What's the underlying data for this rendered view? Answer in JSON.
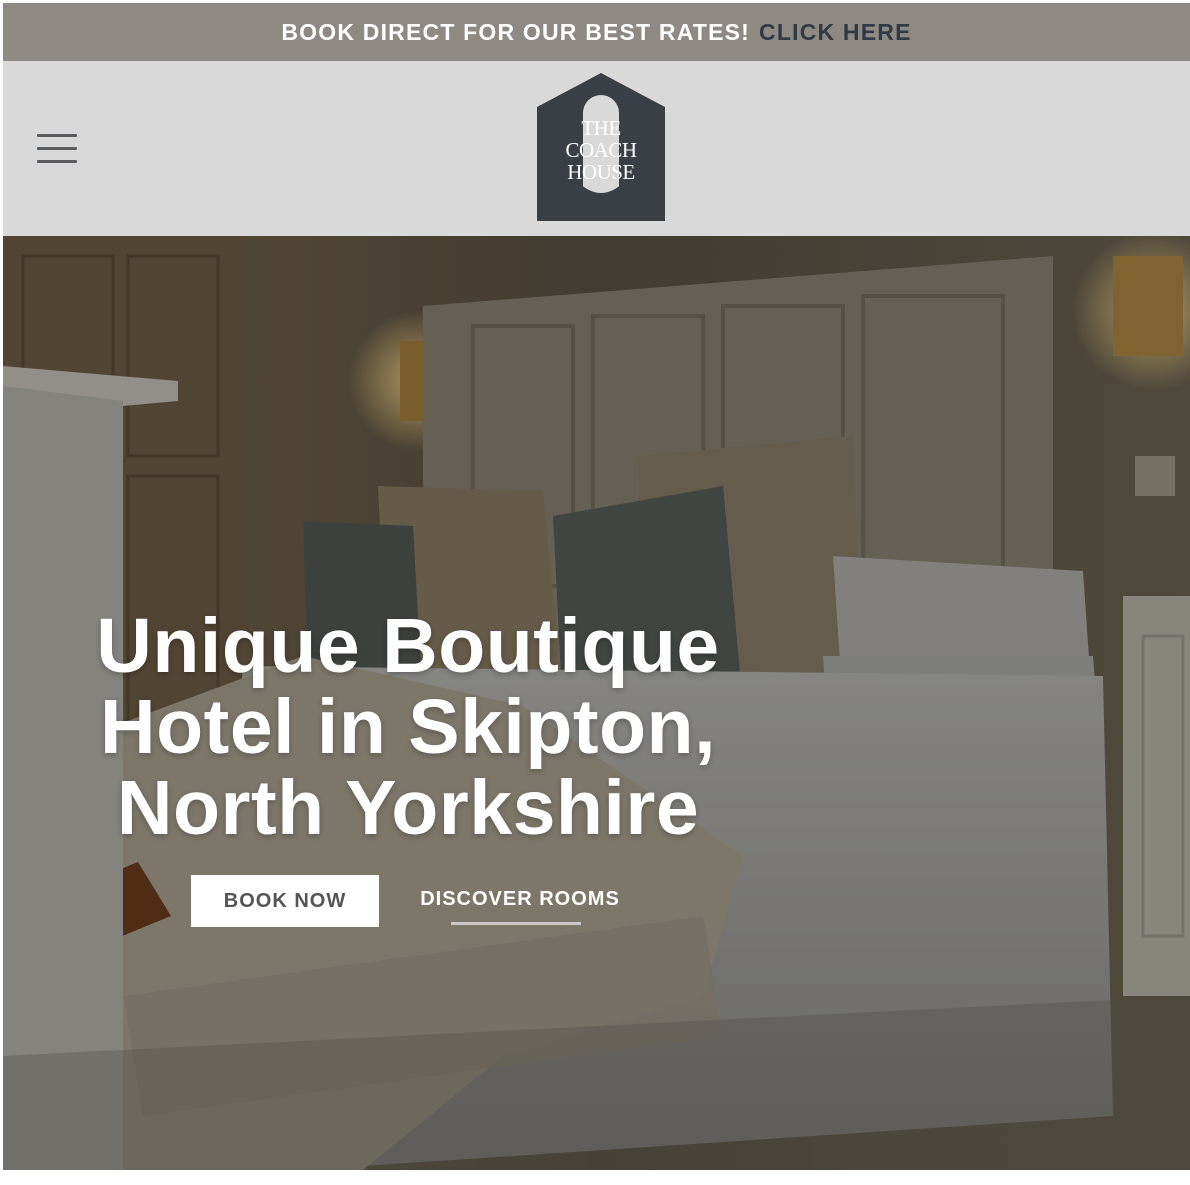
{
  "announcement": {
    "text": "BOOK DIRECT FOR OUR BEST RATES!",
    "link_label": "CLICK HERE"
  },
  "header": {
    "menu_icon": "hamburger-menu-icon",
    "logo": {
      "line1": "THE",
      "line2": "COACH",
      "line3": "HOUSE"
    }
  },
  "hero": {
    "title_line1": "Unique Boutique",
    "title_line2": "Hotel in Skipton,",
    "title_line3": "North Yorkshire",
    "book_label": "BOOK NOW",
    "discover_label": "DISCOVER ROOMS"
  },
  "colors": {
    "announcement_bg": "#8e8a83",
    "header_bg": "#d9d9d9",
    "logo": "#3a3f45",
    "link_accent": "#2f3a44"
  }
}
